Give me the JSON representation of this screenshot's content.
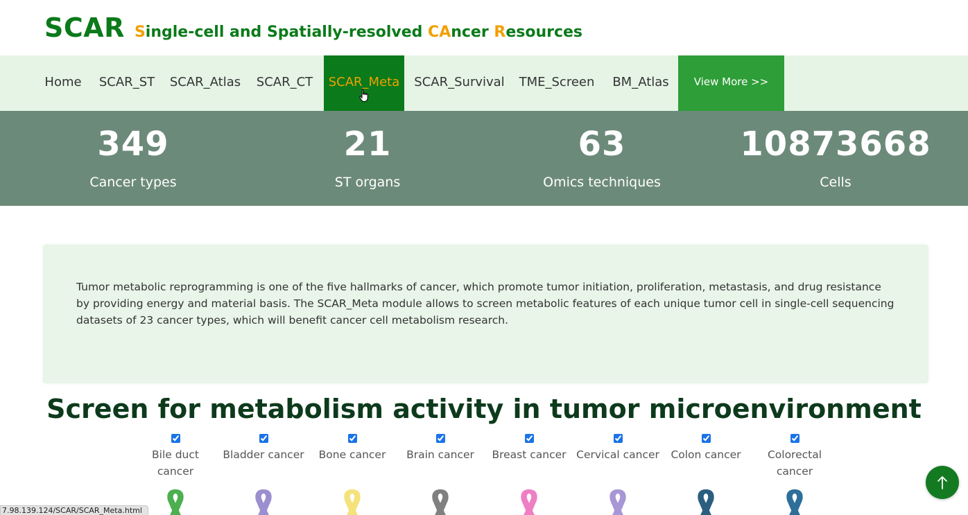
{
  "header": {
    "logo": "SCAR",
    "tagline": {
      "s": "S",
      "p1": "ingle-cell and Spatially-resolved ",
      "ca": "CA",
      "p2": "ncer ",
      "r": "R",
      "p3": "esources"
    }
  },
  "nav": {
    "items": [
      {
        "label": "Home"
      },
      {
        "label": "SCAR_ST"
      },
      {
        "label": "SCAR_Atlas"
      },
      {
        "label": "SCAR_CT"
      },
      {
        "label": "SCAR_Meta",
        "active": true
      },
      {
        "label": "SCAR_Survival"
      },
      {
        "label": "TME_Screen"
      },
      {
        "label": "BM_Atlas"
      }
    ],
    "more": "View More >>"
  },
  "stats": [
    {
      "value": "349",
      "label": "Cancer types"
    },
    {
      "value": "21",
      "label": "ST organs"
    },
    {
      "value": "63",
      "label": "Omics techniques"
    },
    {
      "value": "10873668",
      "label": "Cells"
    }
  ],
  "description": "Tumor metabolic reprogramming is one of the five hallmarks of cancer, which promote tumor initiation, proliferation, metastasis, and drug resistance by providing energy and material basis. The SCAR_Meta module allows to screen metabolic features of each unique tumor cell in single-cell sequencing datasets of 23 cancer types, which will benefit cancer cell metabolism research.",
  "section": {
    "title": "Screen for metabolism activity in tumor microenvironment",
    "cancers": [
      {
        "label": "Bile duct cancer",
        "checked": true,
        "ribbon_color": "#4caf50"
      },
      {
        "label": "Bladder cancer",
        "checked": true,
        "ribbon_color": "#9c8fd0"
      },
      {
        "label": "Bone cancer",
        "checked": true,
        "ribbon_color": "#f5e27a"
      },
      {
        "label": "Brain cancer",
        "checked": true,
        "ribbon_color": "#808080"
      },
      {
        "label": "Breast cancer",
        "checked": true,
        "ribbon_color": "#ef7fc4"
      },
      {
        "label": "Cervical cancer",
        "checked": true,
        "ribbon_color": "#a897d6"
      },
      {
        "label": "Colon cancer",
        "checked": true,
        "ribbon_color": "#2b5f7f"
      },
      {
        "label": "Colorectal cancer",
        "checked": true,
        "ribbon_color": "#2e6f9a"
      }
    ]
  },
  "status_url": "7.98.139.124/SCAR/SCAR_Meta.html",
  "colors": {
    "brand_green": "#0b7a1a",
    "accent_orange": "#f0a000",
    "nav_bg": "#e5f4e5",
    "stats_bg": "#6c8a7a",
    "desc_bg": "#e8f5e8"
  },
  "icons": {
    "cursor": "hand-pointer-icon",
    "back_to_top": "arrow-up-icon"
  }
}
